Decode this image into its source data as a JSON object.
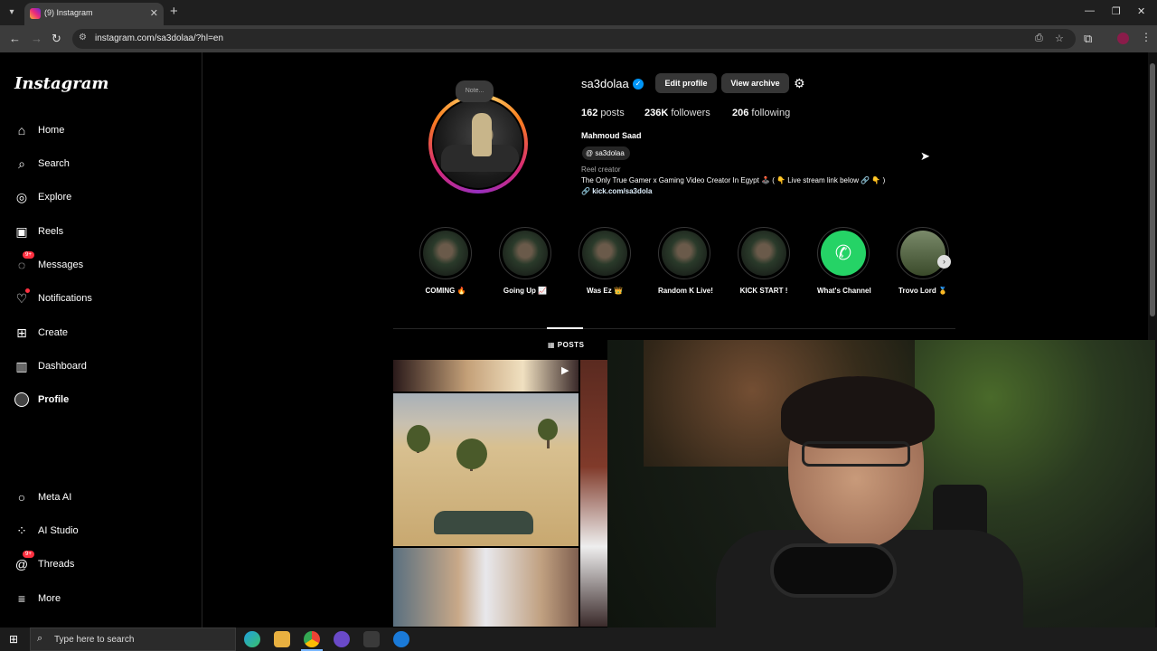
{
  "browser": {
    "tab_title": "(9) Instagram",
    "url": "instagram.com/sa3dolaa/?hl=en",
    "tab_menu_icon": "chevron-down-icon",
    "new_tab_icon": "plus-icon"
  },
  "sidebar": {
    "logo": "Instagram",
    "items": [
      {
        "label": "Home",
        "icon": "home-icon"
      },
      {
        "label": "Search",
        "icon": "search-icon"
      },
      {
        "label": "Explore",
        "icon": "compass-icon"
      },
      {
        "label": "Reels",
        "icon": "reels-icon"
      },
      {
        "label": "Messages",
        "icon": "messenger-icon",
        "badge": "9+"
      },
      {
        "label": "Notifications",
        "icon": "heart-icon"
      },
      {
        "label": "Create",
        "icon": "plus-square-icon"
      },
      {
        "label": "Dashboard",
        "icon": "chart-icon"
      },
      {
        "label": "Profile",
        "icon": "avatar-icon"
      }
    ],
    "bottom_items": [
      {
        "label": "Meta AI",
        "icon": "ring-icon"
      },
      {
        "label": "AI Studio",
        "icon": "grid-icon"
      },
      {
        "label": "Threads",
        "icon": "threads-icon",
        "badge": "9+"
      },
      {
        "label": "More",
        "icon": "hamburger-icon"
      }
    ]
  },
  "profile": {
    "note": "Note...",
    "username": "sa3dolaa",
    "edit_profile": "Edit profile",
    "view_archive": "View archive",
    "posts_count": "162",
    "posts_label": "posts",
    "followers_count": "236K",
    "followers_label": "followers",
    "following_count": "206",
    "following_label": "following",
    "full_name": "Mahmoud Saad",
    "threads_handle": "sa3dolaa",
    "category": "Reel creator",
    "bio": "The Only True Gamer x Gaming Video Creator In Egypt 🕹️ ( 👇 Live stream link below 🔗 👇 )",
    "link": "kick.com/sa3dola"
  },
  "highlights": [
    {
      "label": "COMING 🔥"
    },
    {
      "label": "Going Up 📈"
    },
    {
      "label": "Was Ez 👑"
    },
    {
      "label": "Random K Live!"
    },
    {
      "label": "KICK START !"
    },
    {
      "label": "What's Channel"
    },
    {
      "label": "Trovo Lord 🥇"
    }
  ],
  "tabs": {
    "posts": "POSTS"
  },
  "taskbar": {
    "search_placeholder": "Type here to search"
  },
  "colors": {
    "accent": "#0095f6",
    "badge": "#ff3040",
    "whatsapp": "#25d366"
  }
}
